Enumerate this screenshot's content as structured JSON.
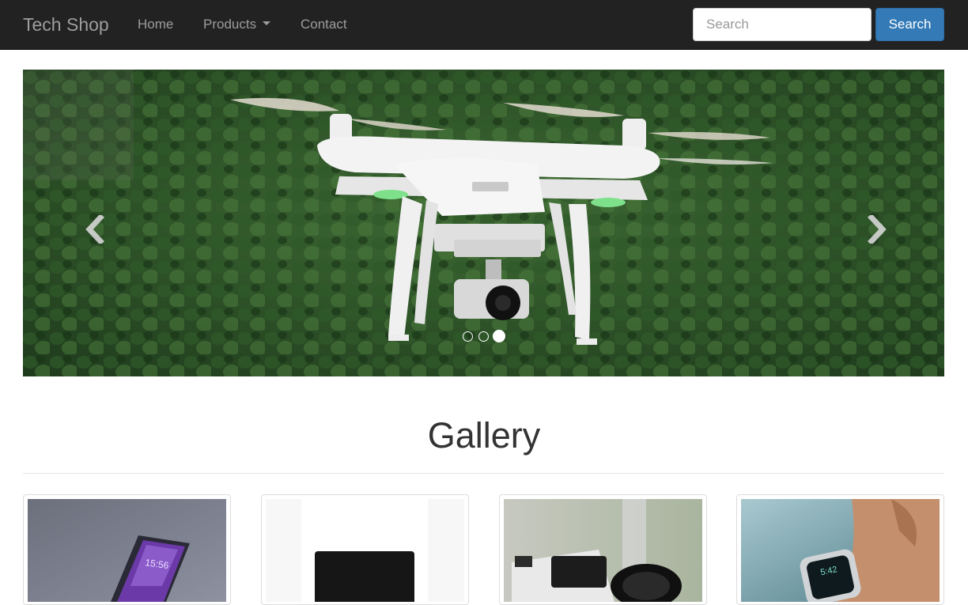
{
  "navbar": {
    "brand": "Tech Shop",
    "links": [
      {
        "label": "Home"
      },
      {
        "label": "Products",
        "has_dropdown": true
      },
      {
        "label": "Contact"
      }
    ],
    "search": {
      "placeholder": "Search",
      "value": "",
      "button_label": "Search"
    }
  },
  "carousel": {
    "slide_image": "white quadcopter drone flying over forest",
    "controls": {
      "prev_icon": "chevron-left-icon",
      "next_icon": "chevron-right-icon"
    },
    "indicators": {
      "count": 3,
      "active_index": 2
    }
  },
  "gallery": {
    "title": "Gallery",
    "items": [
      {
        "image": "smartphone on gray background"
      },
      {
        "image": "laptop on white background"
      },
      {
        "image": "dslr camera with lens"
      },
      {
        "image": "smartwatch on wrist"
      }
    ]
  },
  "colors": {
    "navbar_bg": "#222222",
    "nav_text": "#9d9d9d",
    "primary_button": "#337ab7"
  }
}
